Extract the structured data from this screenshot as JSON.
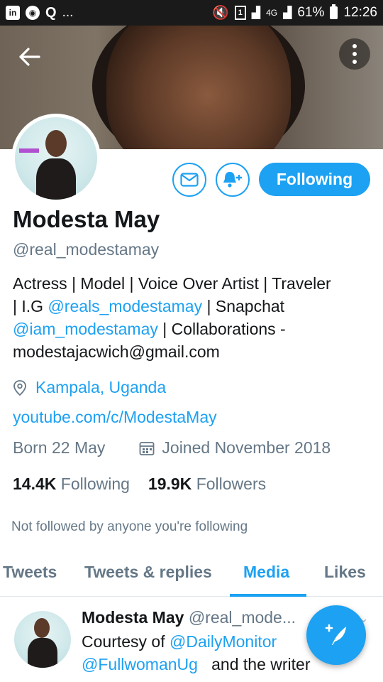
{
  "status_bar": {
    "left_icons": [
      "linkedin-icon",
      "o-icon",
      "q-icon"
    ],
    "more": "...",
    "sim": "1",
    "network": "4G",
    "battery": "61%",
    "time": "12:26"
  },
  "profile": {
    "name": "Modesta May",
    "handle": "@real_modestamay",
    "bio": {
      "line1": "Actress | Model | Voice Over Artist | Traveler",
      "line2_pre": "| I.G ",
      "line2_link": "@reals_modestamay",
      "line2_post": " | Snapchat",
      "line3_link": "@iam_modestamay",
      "line3_post": " | Collaborations -",
      "line4": "modestajacwich@gmail.com"
    },
    "location": "Kampala, Uganda",
    "website": "youtube.com/c/ModestaMay",
    "born": "Born 22 May",
    "joined": "Joined November 2018",
    "following_count": "14.4K",
    "following_label": "Following",
    "followers_count": "19.9K",
    "followers_label": "Followers",
    "not_followed": "Not followed by anyone you're following"
  },
  "actions": {
    "follow_label": "Following"
  },
  "tabs": [
    {
      "label": "Tweets"
    },
    {
      "label": "Tweets & replies"
    },
    {
      "label": "Media"
    },
    {
      "label": "Likes"
    }
  ],
  "tweet": {
    "author": "Modesta May",
    "handle": "@real_mode...",
    "line1_pre": "Courtesy of ",
    "line1_link": "@DailyMonitor",
    "line2_link": "@FullwomanUg",
    "line2_post": "   and the writer"
  },
  "colors": {
    "accent": "#1da1f2",
    "muted": "#657786",
    "text": "#14171a"
  }
}
